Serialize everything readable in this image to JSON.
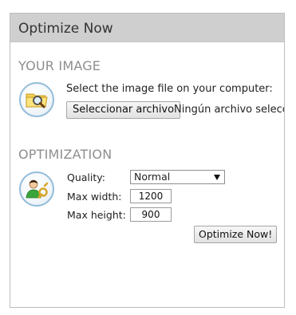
{
  "panel": {
    "title": "Optimize Now"
  },
  "your_image": {
    "heading": "YOUR IMAGE",
    "icon": "folder-search-icon",
    "instruction": "Select the image file on your computer:",
    "choose_file_label": "Seleccionar archivo",
    "file_status": "Ningún archivo seleccionado"
  },
  "optimization": {
    "heading": "OPTIMIZATION",
    "icon": "user-settings-icon",
    "quality_label": "Quality:",
    "quality_value": "Normal",
    "max_width_label": "Max width:",
    "max_width_value": "1200",
    "max_height_label": "Max height:",
    "max_height_value": "900",
    "submit_label": "Optimize Now!"
  },
  "colors": {
    "header_bg": "#cfcfcf",
    "section_heading": "#8e8e8e",
    "icon_ring": "#93bcd9"
  }
}
